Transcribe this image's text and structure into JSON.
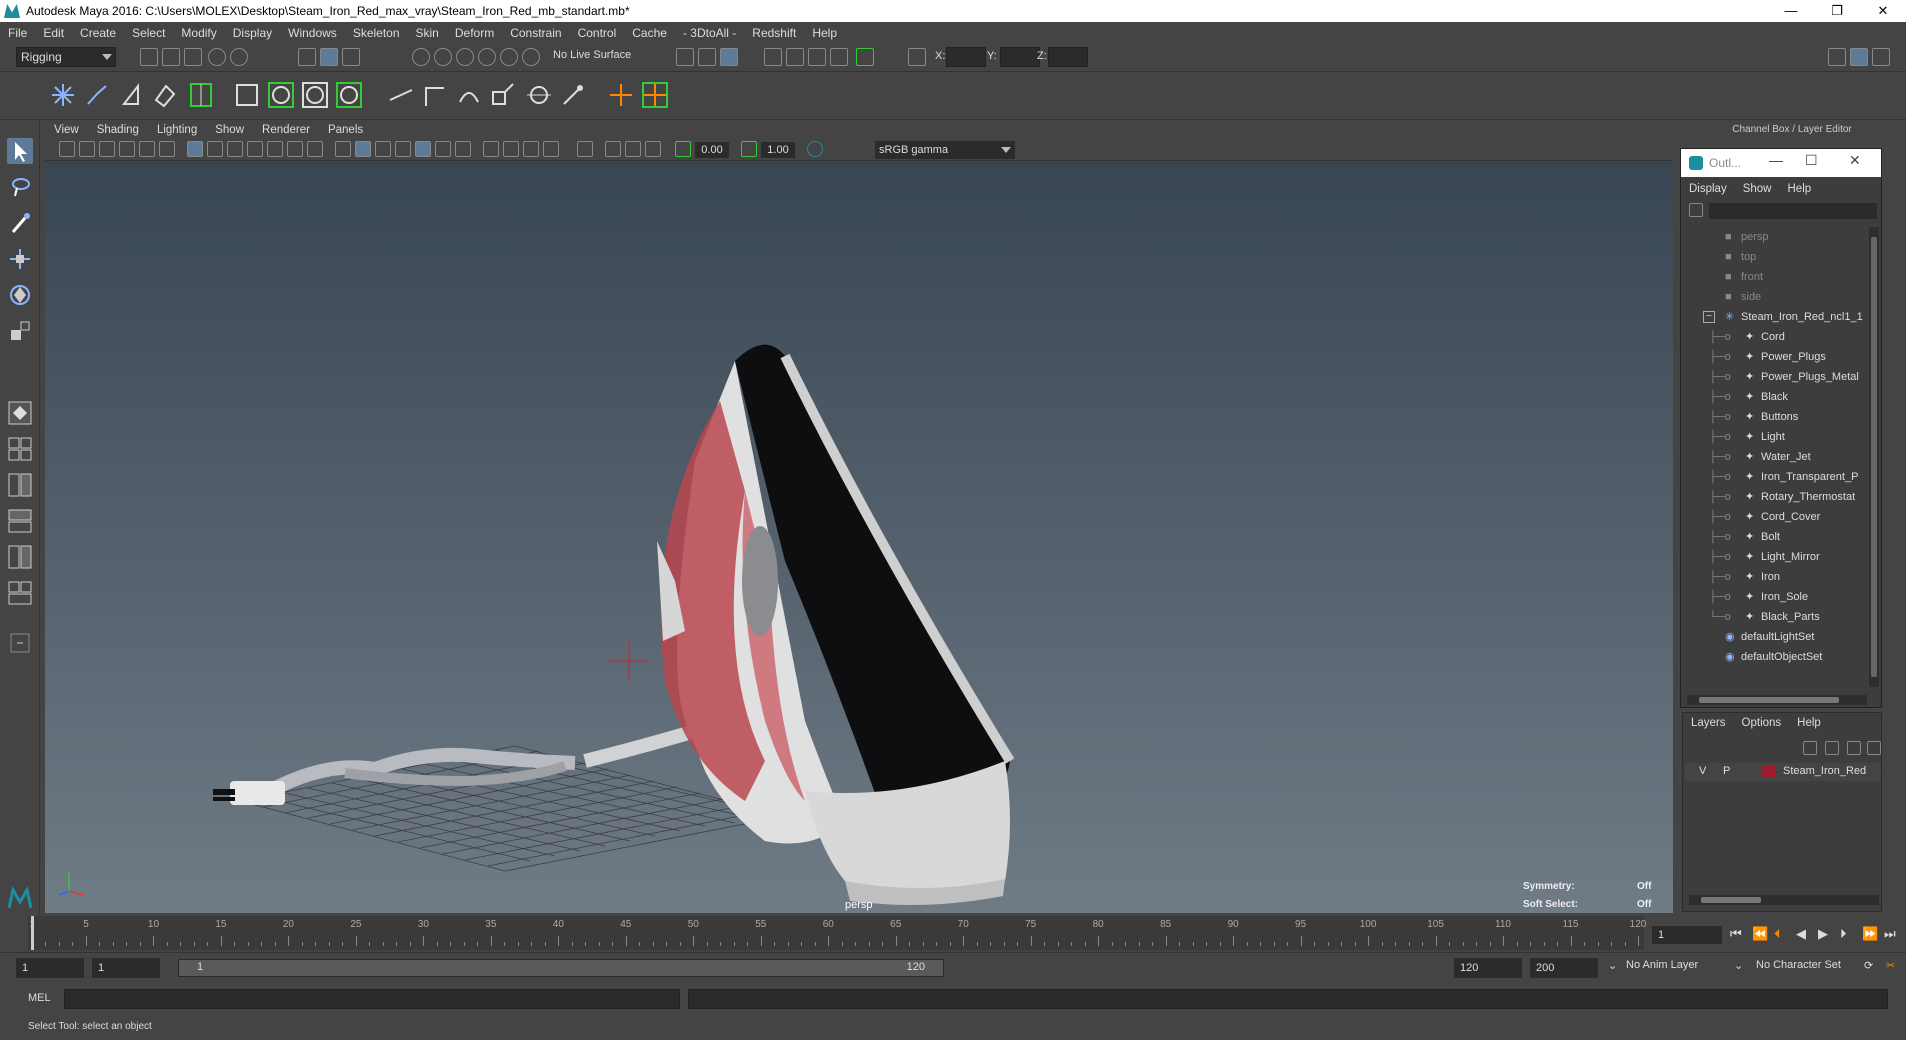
{
  "window": {
    "title": "Autodesk Maya 2016: C:\\Users\\MOLEX\\Desktop\\Steam_Iron_Red_max_vray\\Steam_Iron_Red_mb_standart.mb*",
    "controls": [
      "—",
      "❐",
      "✕"
    ]
  },
  "menubar": [
    "File",
    "Edit",
    "Create",
    "Select",
    "Modify",
    "Display",
    "Windows",
    "Skeleton",
    "Skin",
    "Deform",
    "Constrain",
    "Control",
    "Cache",
    "- 3DtoAll -",
    "Redshift",
    "Help"
  ],
  "statusline": {
    "mode": "Rigging",
    "live_surface": "No Live Surface",
    "x_label": "X:",
    "y_label": "Y:",
    "z_label": "Z:"
  },
  "viewport": {
    "menu": [
      "View",
      "Shading",
      "Lighting",
      "Show",
      "Renderer",
      "Panels"
    ],
    "exposure": "0.00",
    "gamma_value": "1.00",
    "color_space": "sRGB gamma",
    "camera_label": "persp",
    "hud": {
      "symmetry_label": "Symmetry:",
      "symmetry_value": "Off",
      "soft_select_label": "Soft Select:",
      "soft_select_value": "Off"
    }
  },
  "channel_box_title": "Channel Box / Layer Editor",
  "outliner": {
    "title": "Outl...",
    "menu": [
      "Display",
      "Show",
      "Help"
    ],
    "cameras": [
      "persp",
      "top",
      "front",
      "side"
    ],
    "group": "Steam_Iron_Red_ncl1_1",
    "children": [
      "Cord",
      "Power_Plugs",
      "Power_Plugs_Metal",
      "Black",
      "Buttons",
      "Light",
      "Water_Jet",
      "Iron_Transparent_P",
      "Rotary_Thermostat",
      "Cord_Cover",
      "Bolt",
      "Light_Mirror",
      "Iron",
      "Iron_Sole",
      "Black_Parts"
    ],
    "sets": [
      "defaultLightSet",
      "defaultObjectSet"
    ]
  },
  "layers": {
    "menu": [
      "Layers",
      "Options",
      "Help"
    ],
    "row": {
      "v": "V",
      "p": "P",
      "name": "Steam_Iron_Red",
      "color": "#9c1b2f"
    }
  },
  "timeline": {
    "ticks": [
      1,
      5,
      10,
      15,
      20,
      25,
      30,
      35,
      40,
      45,
      50,
      55,
      60,
      65,
      70,
      75,
      80,
      85,
      90,
      95,
      100,
      105,
      110,
      115,
      120
    ],
    "current_frame": "1"
  },
  "range": {
    "start": "1",
    "anim_start": "1",
    "range_start_label": "1",
    "range_end_label": "120",
    "anim_end": "120",
    "end": "200",
    "anim_layer": "No Anim Layer",
    "character_set": "No Character Set"
  },
  "commandline": {
    "label": "MEL"
  },
  "helpline": "Select Tool: select an object",
  "colors": {
    "accent": "#5d7a99",
    "maya_teal": "#1b8fa0",
    "iron_red": "#9c1b2f"
  }
}
